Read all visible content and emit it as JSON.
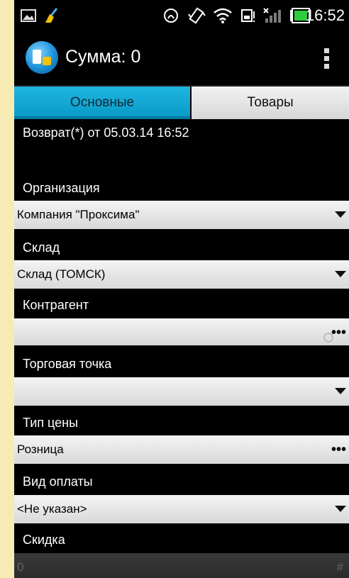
{
  "status_bar": {
    "time": "16:52",
    "icons": [
      "image-icon",
      "broom-icon",
      "nfc-icon",
      "vibrate-icon",
      "wifi-icon",
      "battery-warning-icon",
      "signal-icon",
      "battery-icon"
    ]
  },
  "action_bar": {
    "title": "Сумма: 0"
  },
  "tabs": [
    {
      "label": "Основные",
      "active": true
    },
    {
      "label": "Товары",
      "active": false
    }
  ],
  "document": {
    "title": "Возврат(*) от 05.03.14 16:52"
  },
  "fields": [
    {
      "label": "Организация",
      "value": "Компания \"Проксима\"",
      "control": "dropdown"
    },
    {
      "label": "Склад",
      "value": "Склад (ТОМСК)",
      "control": "dropdown"
    },
    {
      "label": "Контрагент",
      "value": "",
      "control": "picker"
    },
    {
      "label": "Торговая точка",
      "value": "",
      "control": "dropdown"
    },
    {
      "label": "Тип цены",
      "value": "Розница",
      "control": "picker"
    },
    {
      "label": "Вид оплаты",
      "value": "<Не указан>",
      "control": "dropdown"
    },
    {
      "label": "Скидка",
      "value": "0",
      "control": "number"
    }
  ],
  "colors": {
    "accent": "#0a9bc8",
    "background": "#000000",
    "frame": "#f6ecb3"
  }
}
